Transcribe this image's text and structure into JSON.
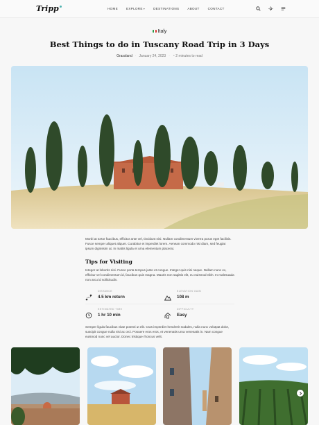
{
  "header": {
    "logo": "Tripp",
    "nav": [
      {
        "label": "HOME",
        "has_caret": false
      },
      {
        "label": "EXPLORE",
        "has_caret": true
      },
      {
        "label": "DESTINATIONS",
        "has_caret": false
      },
      {
        "label": "ABOUT",
        "has_caret": false
      },
      {
        "label": "CONTACT",
        "has_caret": false
      }
    ],
    "icons": [
      "search-icon",
      "sun-icon",
      "menu-icon"
    ]
  },
  "article": {
    "category": "Italy",
    "title": "Best Things to do in Tuscany Road Trip in 3 Days",
    "author": "Grassland",
    "date": "January 24, 2023",
    "read_time": "2 minutes to read",
    "intro": "Morbi at tortor faucibus, efficitur ante vel, tincidunt nisi. Nullam condimentum viverra purus eget facilisis. Fusce semper aliquet aliquet. Curabitur et imperdiet lorem. Aenean commodo nisi diam, sed feugiat ipsum dignissim at. In mattis ligula et urna elementum placerat.",
    "tips_heading": "Tips for Visiting",
    "tips_text": "Integer at lobortis nisi. Fusce porta tempus justo et congue. Integer quis nisi neque. Nullam nunc ex, efficitur vel condimentum id, faucibus quis magna. Mauris non sagittis elit, eu euismod nibh. In malesuada non arcu id sollicitudin.",
    "stats": [
      {
        "label": "DISTANCE",
        "value": "4.5 km return",
        "icon": "route-icon"
      },
      {
        "label": "ELEVATION GAIN",
        "value": "108 m",
        "icon": "mountain-icon"
      },
      {
        "label": "ESTIMATED TIME",
        "value": "1 hr 10 min",
        "icon": "clock-icon"
      },
      {
        "label": "DIFFICULTY",
        "value": "Easy",
        "icon": "difficulty-icon"
      }
    ],
    "closing": "Semper ligula faucibus vitae potenti ut elit. Cras imperdiet hendrerit sodales, nulla nunc volutpat dolor, suscipit congue nulla nisi ac orci. Posuere eros eros, et venenatis urna venenatis in. Nam congue euismod nunc vel auctor. Donec tristique rhoncus velit."
  },
  "colors": {
    "accent": "#4fb3b0",
    "flag_green": "#2e9b4a",
    "flag_red": "#d6332e"
  }
}
